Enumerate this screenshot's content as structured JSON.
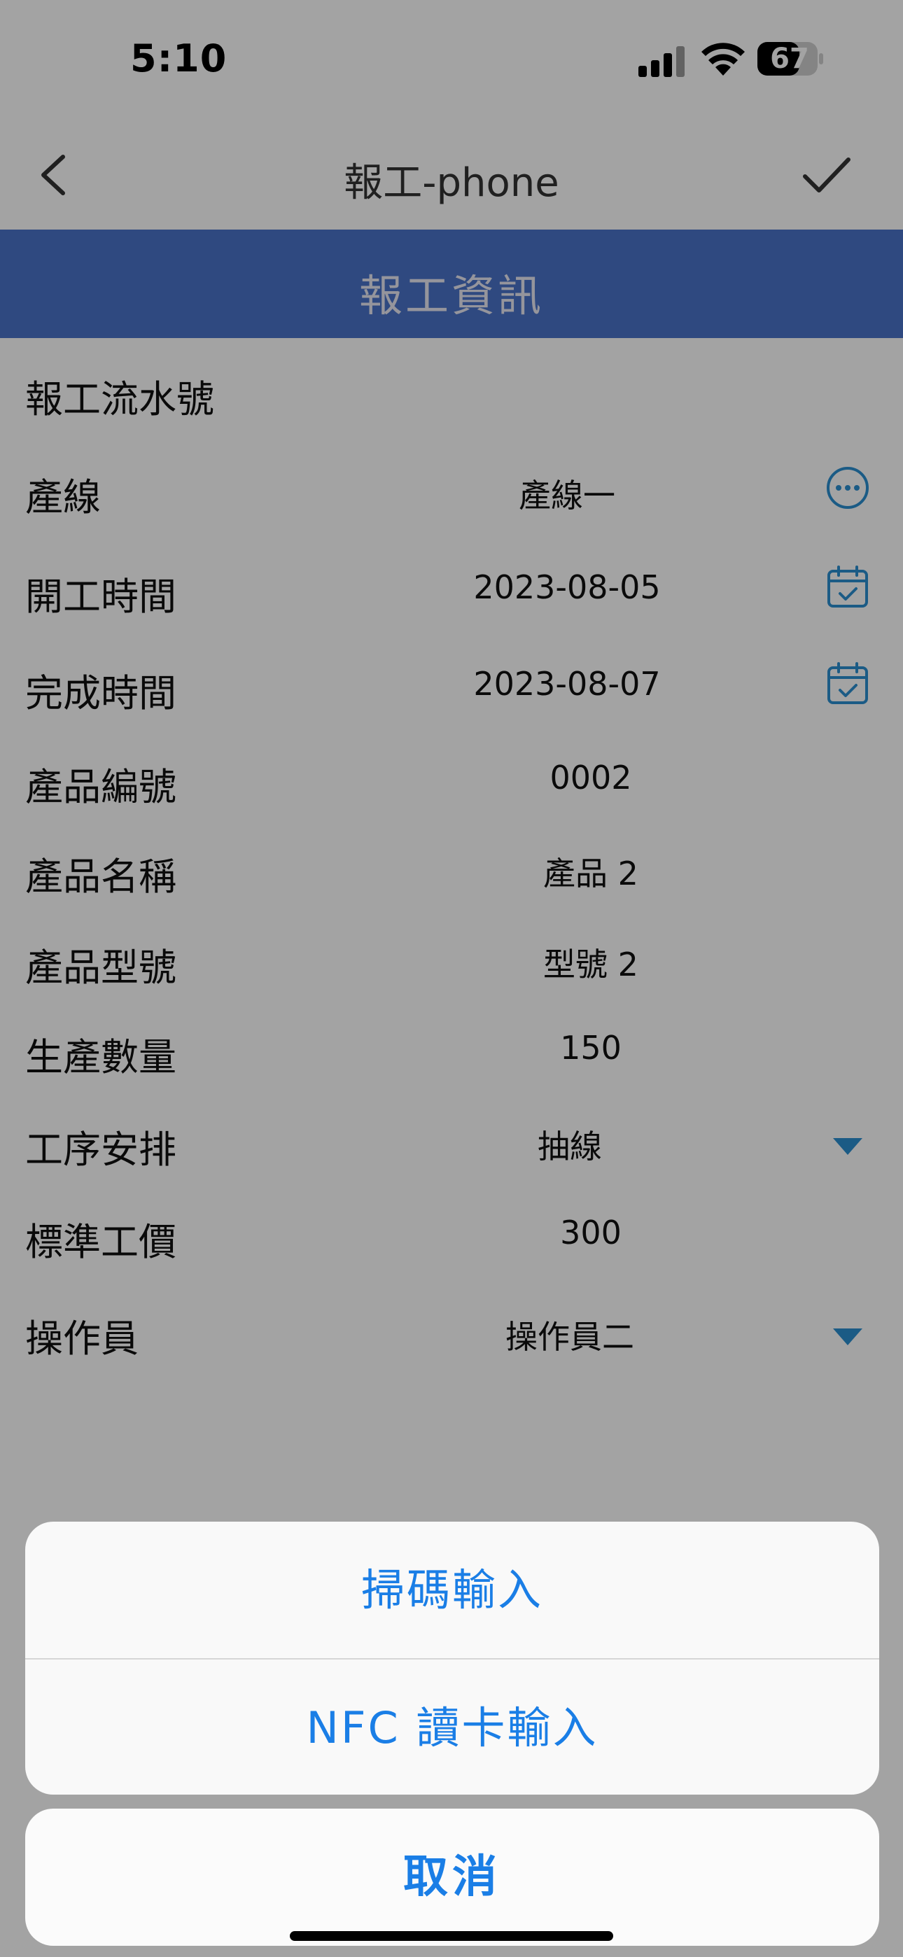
{
  "status_bar": {
    "time": "5:10",
    "battery": "67"
  },
  "nav": {
    "title": "報工-phone"
  },
  "section": {
    "title": "報工資訊"
  },
  "form": {
    "rows": [
      {
        "label": "報工流水號",
        "value": ""
      },
      {
        "label": "產線",
        "value": "產線一",
        "icon": "more-icon"
      },
      {
        "label": "開工時間",
        "value": "2023-08-05",
        "icon": "calendar-icon"
      },
      {
        "label": "完成時間",
        "value": "2023-08-07",
        "icon": "calendar-icon"
      },
      {
        "label": "產品編號",
        "value": "0002"
      },
      {
        "label": "產品名稱",
        "value": "產品 2"
      },
      {
        "label": "產品型號",
        "value": "型號 2"
      },
      {
        "label": "生產數量",
        "value": "150"
      },
      {
        "label": "工序安排",
        "value": "抽線",
        "icon": "dropdown-triangle-icon"
      },
      {
        "label": "標準工價",
        "value": "300"
      },
      {
        "label": "操作員",
        "value": "操作員二",
        "icon": "dropdown-triangle-icon"
      }
    ]
  },
  "action_sheet": {
    "actions": [
      {
        "label": "掃碼輸入"
      },
      {
        "label": "NFC 讀卡輸入"
      }
    ],
    "cancel_label": "取消"
  },
  "colors": {
    "accent": "#1a7ee6",
    "header_blue": "#4a73c9",
    "icon_teal": "#2b8fd1"
  }
}
